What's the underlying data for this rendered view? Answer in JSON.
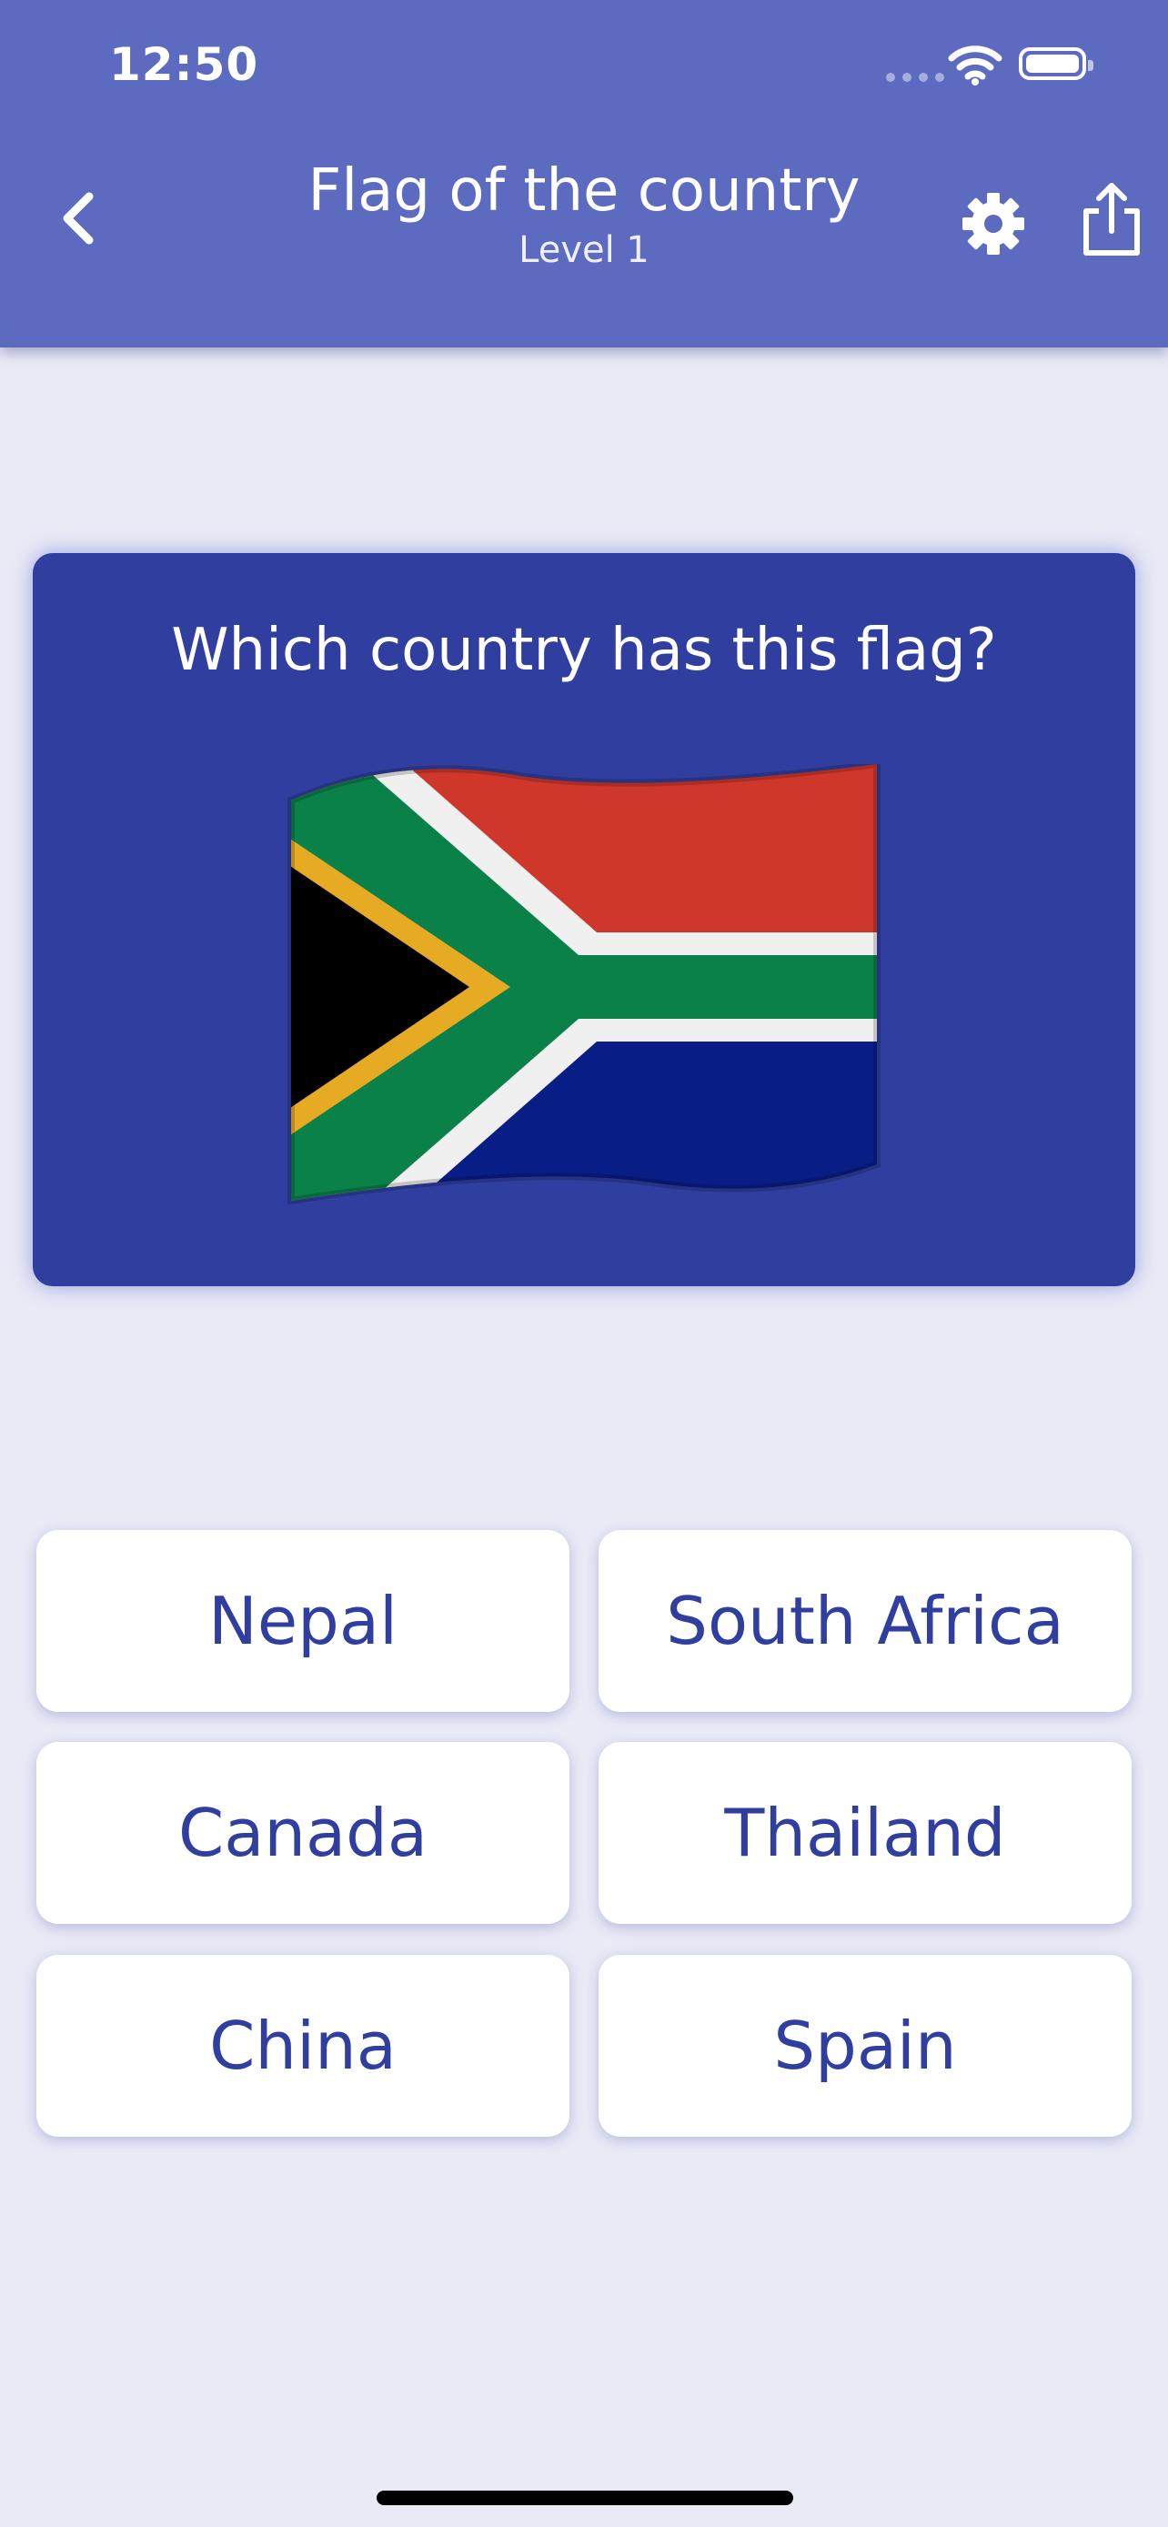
{
  "status_bar": {
    "time": "12:50"
  },
  "header": {
    "title": "Flag of the country",
    "subtitle": "Level 1",
    "back_icon": "chevron-left-icon",
    "settings_icon": "gear-icon",
    "share_icon": "share-icon"
  },
  "question": {
    "text": "Which country has this flag?",
    "flag": "South Africa flag"
  },
  "answers": [
    {
      "label": "Nepal"
    },
    {
      "label": "South Africa"
    },
    {
      "label": "Canada"
    },
    {
      "label": "Thailand"
    },
    {
      "label": "China"
    },
    {
      "label": "Spain"
    }
  ],
  "colors": {
    "header": "#5C6BC0",
    "card": "#303F9F",
    "background": "#E8EAF6",
    "answer_text": "#303F9F"
  }
}
